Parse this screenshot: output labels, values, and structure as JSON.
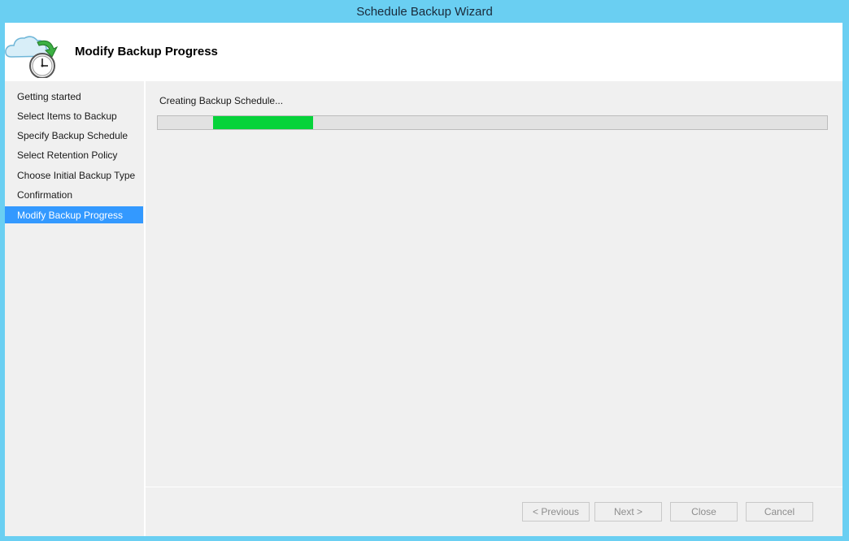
{
  "window": {
    "title": "Schedule Backup Wizard"
  },
  "header": {
    "title": "Modify Backup Progress",
    "icon": "cloud-backup-clock-icon"
  },
  "steps": [
    {
      "label": "Getting started",
      "active": false
    },
    {
      "label": "Select Items to Backup",
      "active": false
    },
    {
      "label": "Specify Backup Schedule",
      "active": false
    },
    {
      "label": "Select Retention Policy",
      "active": false
    },
    {
      "label": "Choose Initial Backup Type",
      "active": false
    },
    {
      "label": "Confirmation",
      "active": false
    },
    {
      "label": "Modify Backup Progress",
      "active": true
    }
  ],
  "progress": {
    "status": "Creating Backup Schedule...",
    "marquee_start_fraction": 0.083,
    "marquee_length_fraction": 0.149,
    "color": "#06d33a"
  },
  "buttons": {
    "previous": "< Previous",
    "next": "Next >",
    "close": "Close",
    "cancel": "Cancel"
  },
  "colors": {
    "titlebar": "#6acff2",
    "selection": "#3399ff"
  }
}
